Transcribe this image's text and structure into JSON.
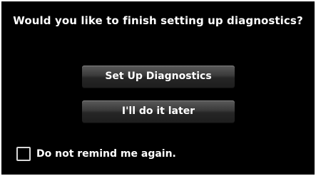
{
  "dialog": {
    "prompt": "Would you like to finish setting up diagnostics?",
    "setup_button_label": "Set Up Diagnostics",
    "later_button_label": "I'll do it later",
    "remind_checkbox_label": "Do not remind me again.",
    "remind_checkbox_checked": false
  },
  "colors": {
    "background": "#000000",
    "text": "#ffffff",
    "frame": "#ffffff"
  }
}
